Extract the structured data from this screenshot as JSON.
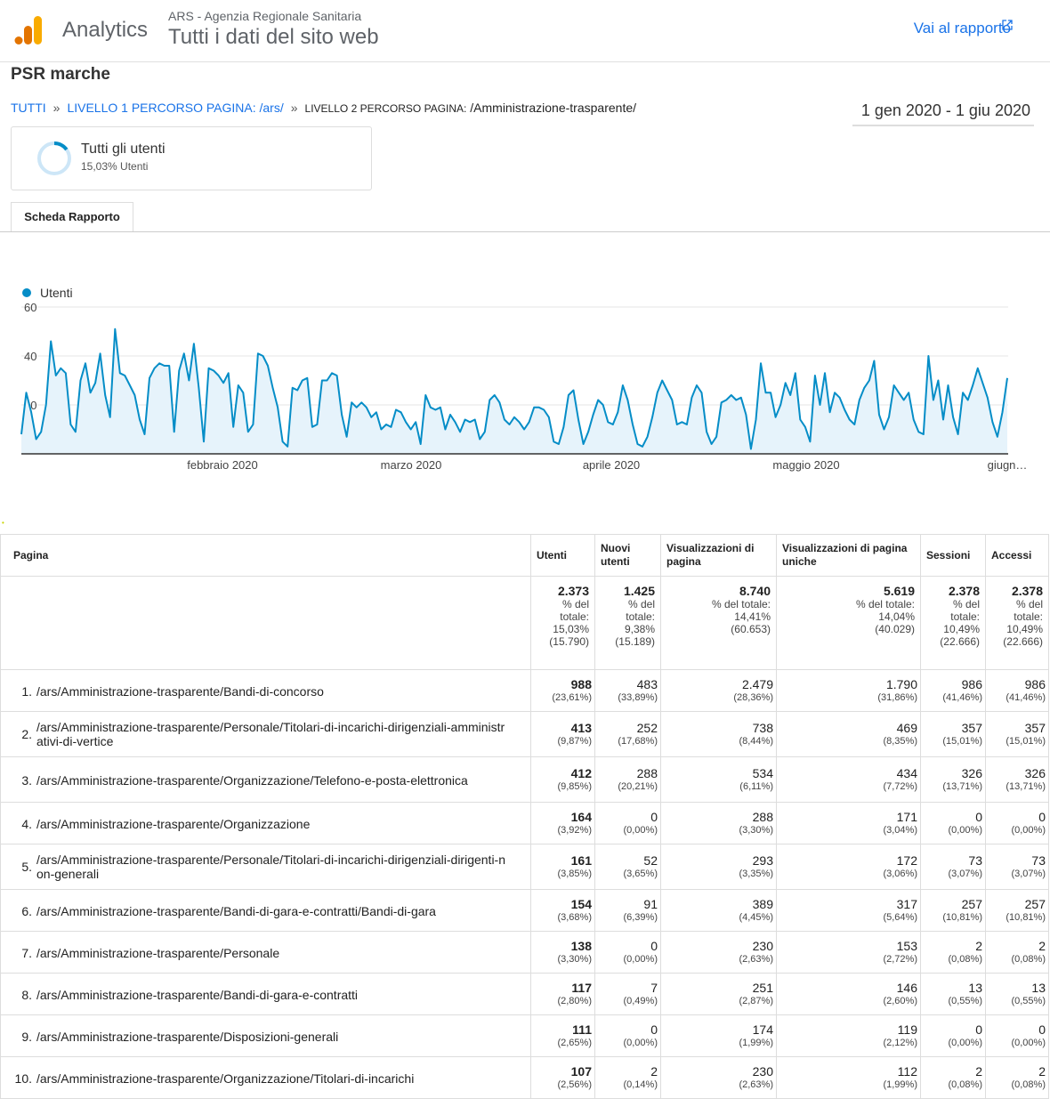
{
  "header": {
    "product_name": "Analytics",
    "account": "ARS - Agenzia Regionale Sanitaria",
    "property": "Tutti i dati del sito web",
    "report_link": "Vai al rapporto",
    "brand_colors": [
      "#f9ab00",
      "#e37400"
    ]
  },
  "view_title": "PSR marche",
  "breadcrumb": {
    "all": "TUTTI",
    "sep": "»",
    "level1_label": "LIVELLO 1 PERCORSO PAGINA:",
    "level1_value": "/ars/",
    "level2_label": "LIVELLO 2 PERCORSO PAGINA:",
    "level2_value": "/Amministrazione-trasparente/"
  },
  "date_range": "1 gen 2020 - 1 giu 2020",
  "segment": {
    "name": "Tutti gli utenti",
    "percent": "15,03% Utenti",
    "share": 0.1503
  },
  "tab": "Scheda Rapporto",
  "chart_data": {
    "type": "line",
    "series": [
      {
        "name": "Utenti",
        "color": "#058dc7",
        "values": [
          8,
          25,
          17,
          6,
          9,
          20,
          46,
          32,
          35,
          33,
          12,
          9,
          30,
          37,
          25,
          29,
          41,
          24,
          15,
          51,
          33,
          32,
          28,
          24,
          14,
          8,
          31,
          35,
          37,
          36,
          36,
          9,
          34,
          41,
          30,
          45,
          27,
          5,
          35,
          34,
          32,
          29,
          33,
          11,
          28,
          25,
          9,
          12,
          41,
          40,
          36,
          27,
          19,
          5,
          3,
          27,
          26,
          30,
          31,
          11,
          12,
          30,
          30,
          33,
          32,
          16,
          7,
          21,
          19,
          21,
          19,
          15,
          17,
          10,
          12,
          11,
          18,
          17,
          13,
          10,
          13,
          4,
          24,
          19,
          18,
          19,
          10,
          16,
          13,
          9,
          14,
          13,
          14,
          6,
          9,
          22,
          24,
          21,
          14,
          12,
          15,
          13,
          10,
          13,
          19,
          19,
          18,
          15,
          5,
          4,
          11,
          24,
          26,
          14,
          4,
          9,
          16,
          22,
          20,
          13,
          12,
          17,
          28,
          22,
          12,
          4,
          3,
          7,
          15,
          25,
          30,
          26,
          22,
          12,
          13,
          12,
          23,
          28,
          25,
          9,
          4,
          7,
          21,
          22,
          24,
          22,
          23,
          16,
          2,
          14,
          37,
          25,
          25,
          15,
          20,
          29,
          24,
          33,
          14,
          11,
          5,
          32,
          20,
          33,
          17,
          25,
          23,
          18,
          14,
          12,
          22,
          27,
          30,
          38,
          16,
          10,
          15,
          28,
          25,
          22,
          25,
          14,
          9,
          8,
          40,
          22,
          30,
          14,
          28,
          15,
          8,
          25,
          22,
          28,
          35,
          29,
          23,
          13,
          7,
          17,
          31
        ]
      }
    ],
    "x_labels": [
      "febbraio 2020",
      "marzo 2020",
      "aprile 2020",
      "maggio 2020",
      "giugn…"
    ],
    "y_ticks": [
      "60",
      "40",
      "20"
    ],
    "ylim": [
      0,
      60
    ],
    "grid": true,
    "legend": "top-left"
  },
  "table": {
    "columns": [
      "Pagina",
      "Utenti",
      "Nuovi utenti",
      "Visualizzazioni di pagina",
      "Visualizzazioni di pagina uniche",
      "Sessioni",
      "Accessi"
    ],
    "totals": [
      {
        "value": "2.373",
        "lines": [
          "% del",
          "totale:",
          "15,03%",
          "(15.790)"
        ]
      },
      {
        "value": "1.425",
        "lines": [
          "% del",
          "totale:",
          "9,38%",
          "(15.189)"
        ]
      },
      {
        "value": "8.740",
        "lines": [
          "% del totale:",
          "14,41%",
          "(60.653)"
        ]
      },
      {
        "value": "5.619",
        "lines": [
          "% del totale:",
          "14,04%",
          "(40.029)"
        ]
      },
      {
        "value": "2.378",
        "lines": [
          "% del",
          "totale:",
          "10,49%",
          "(22.666)"
        ]
      },
      {
        "value": "2.378",
        "lines": [
          "% del",
          "totale:",
          "10,49%",
          "(22.666)"
        ]
      }
    ],
    "rows": [
      {
        "rank": "1.",
        "page": "/ars/Amministrazione-trasparente/Bandi-di-concorso",
        "cells": [
          [
            "988",
            "(23,61%)"
          ],
          [
            "483",
            "(33,89%)"
          ],
          [
            "2.479",
            "(28,36%)"
          ],
          [
            "1.790",
            "(31,86%)"
          ],
          [
            "986",
            "(41,46%)"
          ],
          [
            "986",
            "(41,46%)"
          ]
        ]
      },
      {
        "rank": "2.",
        "page": "/ars/Amministrazione-trasparente/Personale/Titolari-di-incarichi-dirigenziali-amministrativi-di-vertice",
        "cells": [
          [
            "413",
            "(9,87%)"
          ],
          [
            "252",
            "(17,68%)"
          ],
          [
            "738",
            "(8,44%)"
          ],
          [
            "469",
            "(8,35%)"
          ],
          [
            "357",
            "(15,01%)"
          ],
          [
            "357",
            "(15,01%)"
          ]
        ]
      },
      {
        "rank": "3.",
        "page": "/ars/Amministrazione-trasparente/Organizzazione/Telefono-e-posta-elettronica",
        "cells": [
          [
            "412",
            "(9,85%)"
          ],
          [
            "288",
            "(20,21%)"
          ],
          [
            "534",
            "(6,11%)"
          ],
          [
            "434",
            "(7,72%)"
          ],
          [
            "326",
            "(13,71%)"
          ],
          [
            "326",
            "(13,71%)"
          ]
        ]
      },
      {
        "rank": "4.",
        "page": "/ars/Amministrazione-trasparente/Organizzazione",
        "cells": [
          [
            "164",
            "(3,92%)"
          ],
          [
            "0",
            "(0,00%)"
          ],
          [
            "288",
            "(3,30%)"
          ],
          [
            "171",
            "(3,04%)"
          ],
          [
            "0",
            "(0,00%)"
          ],
          [
            "0",
            "(0,00%)"
          ]
        ]
      },
      {
        "rank": "5.",
        "page": "/ars/Amministrazione-trasparente/Personale/Titolari-di-incarichi-dirigenziali-dirigenti-non-generali",
        "cells": [
          [
            "161",
            "(3,85%)"
          ],
          [
            "52",
            "(3,65%)"
          ],
          [
            "293",
            "(3,35%)"
          ],
          [
            "172",
            "(3,06%)"
          ],
          [
            "73",
            "(3,07%)"
          ],
          [
            "73",
            "(3,07%)"
          ]
        ]
      },
      {
        "rank": "6.",
        "page": "/ars/Amministrazione-trasparente/Bandi-di-gara-e-contratti/Bandi-di-gara",
        "cells": [
          [
            "154",
            "(3,68%)"
          ],
          [
            "91",
            "(6,39%)"
          ],
          [
            "389",
            "(4,45%)"
          ],
          [
            "317",
            "(5,64%)"
          ],
          [
            "257",
            "(10,81%)"
          ],
          [
            "257",
            "(10,81%)"
          ]
        ]
      },
      {
        "rank": "7.",
        "page": "/ars/Amministrazione-trasparente/Personale",
        "cells": [
          [
            "138",
            "(3,30%)"
          ],
          [
            "0",
            "(0,00%)"
          ],
          [
            "230",
            "(2,63%)"
          ],
          [
            "153",
            "(2,72%)"
          ],
          [
            "2",
            "(0,08%)"
          ],
          [
            "2",
            "(0,08%)"
          ]
        ]
      },
      {
        "rank": "8.",
        "page": "/ars/Amministrazione-trasparente/Bandi-di-gara-e-contratti",
        "cells": [
          [
            "117",
            "(2,80%)"
          ],
          [
            "7",
            "(0,49%)"
          ],
          [
            "251",
            "(2,87%)"
          ],
          [
            "146",
            "(2,60%)"
          ],
          [
            "13",
            "(0,55%)"
          ],
          [
            "13",
            "(0,55%)"
          ]
        ]
      },
      {
        "rank": "9.",
        "page": "/ars/Amministrazione-trasparente/Disposizioni-generali",
        "cells": [
          [
            "111",
            "(2,65%)"
          ],
          [
            "0",
            "(0,00%)"
          ],
          [
            "174",
            "(1,99%)"
          ],
          [
            "119",
            "(2,12%)"
          ],
          [
            "0",
            "(0,00%)"
          ],
          [
            "0",
            "(0,00%)"
          ]
        ]
      },
      {
        "rank": "10.",
        "page": "/ars/Amministrazione-trasparente/Organizzazione/Titolari-di-incarichi",
        "cells": [
          [
            "107",
            "(2,56%)"
          ],
          [
            "2",
            "(0,14%)"
          ],
          [
            "230",
            "(2,63%)"
          ],
          [
            "112",
            "(1,99%)"
          ],
          [
            "2",
            "(0,08%)"
          ],
          [
            "2",
            "(0,08%)"
          ]
        ]
      }
    ]
  }
}
